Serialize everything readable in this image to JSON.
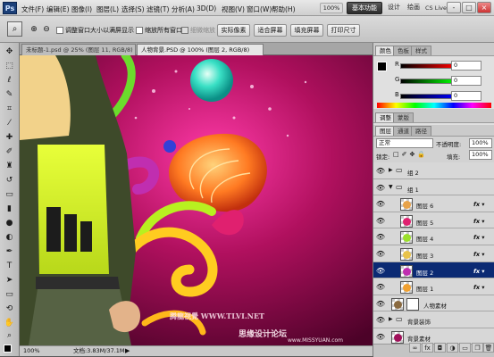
{
  "app": {
    "logo": "Ps",
    "menu": [
      "文件(F)",
      "编辑(E)",
      "图像(I)",
      "图层(L)",
      "选择(S)",
      "滤镜(T)",
      "分析(A)",
      "3D(D)",
      "视图(V)",
      "窗口(W)",
      "帮助(H)"
    ],
    "zoom": "100%",
    "workspace_tabs": [
      "基本功能",
      "设计",
      "绘画"
    ],
    "cs_live": "CS Live",
    "window_buttons": [
      "-",
      "□",
      "×"
    ]
  },
  "options_bar": {
    "check1_label": "调整窗口大小以满屏显示",
    "check2_label": "缩放所有窗口",
    "check3_label": "细微缩放",
    "btn_actual": "实际像素",
    "btn_fit": "适合屏幕",
    "btn_fill": "填充屏幕",
    "btn_print": "打印尺寸"
  },
  "document": {
    "tabs": [
      "未标题-1.psd @ 25% (图层 11, RGB/8)",
      "人物背景.PSD @ 100% (图层 2, RGB/8)"
    ],
    "active_tab": 1,
    "status_zoom": "100%",
    "status_doc": "文档:3.83M/37.1M",
    "watermark1": "腾龍視覺 WWW.TLVI.NET",
    "watermark2": "思缘设计论坛",
    "watermark3": "www.MISSYUAN.com"
  },
  "color_panel": {
    "tabs": [
      "颜色",
      "色板",
      "样式"
    ],
    "channels": [
      "R",
      "G",
      "B"
    ],
    "values": [
      "0",
      "0",
      "0"
    ]
  },
  "adjust_panel": {
    "tabs": [
      "调整",
      "蒙版"
    ]
  },
  "layers_panel": {
    "tabs": [
      "图层",
      "通道",
      "路径"
    ],
    "blend_mode": "正常",
    "opacity_label": "不透明度:",
    "opacity": "100%",
    "lock_label": "锁定:",
    "fill_label": "填充:",
    "fill": "100%",
    "layers": [
      {
        "name": "组 2",
        "type": "group",
        "indent": 0,
        "fx": false,
        "open": false
      },
      {
        "name": "组 1",
        "type": "group",
        "indent": 0,
        "fx": false,
        "open": true
      },
      {
        "name": "图层 6",
        "type": "layer",
        "indent": 1,
        "fx": true,
        "color": "#e8a34a"
      },
      {
        "name": "图层 5",
        "type": "layer",
        "indent": 1,
        "fx": true,
        "color": "#e02170"
      },
      {
        "name": "图层 4",
        "type": "layer",
        "indent": 1,
        "fx": true,
        "color": "#9be02a"
      },
      {
        "name": "图层 3",
        "type": "layer",
        "indent": 1,
        "fx": true,
        "color": "#e8c34a"
      },
      {
        "name": "图层 2",
        "type": "layer",
        "indent": 1,
        "fx": true,
        "color": "#c02eb0",
        "selected": true
      },
      {
        "name": "图层 1",
        "type": "layer",
        "indent": 1,
        "fx": true,
        "color": "#f0a030"
      },
      {
        "name": "人物素材",
        "type": "layer",
        "indent": 0,
        "fx": false,
        "color": "#8a6a40",
        "mask": true
      },
      {
        "name": "背景装饰",
        "type": "group",
        "indent": 0,
        "fx": false,
        "open": false
      },
      {
        "name": "背景素材",
        "type": "layer",
        "indent": 0,
        "fx": false,
        "color": "#a0105a"
      }
    ],
    "bottom_icons": [
      "link-icon",
      "fx-icon",
      "mask-icon",
      "adjust-icon",
      "folder-icon",
      "new-layer-icon",
      "trash-icon"
    ]
  }
}
